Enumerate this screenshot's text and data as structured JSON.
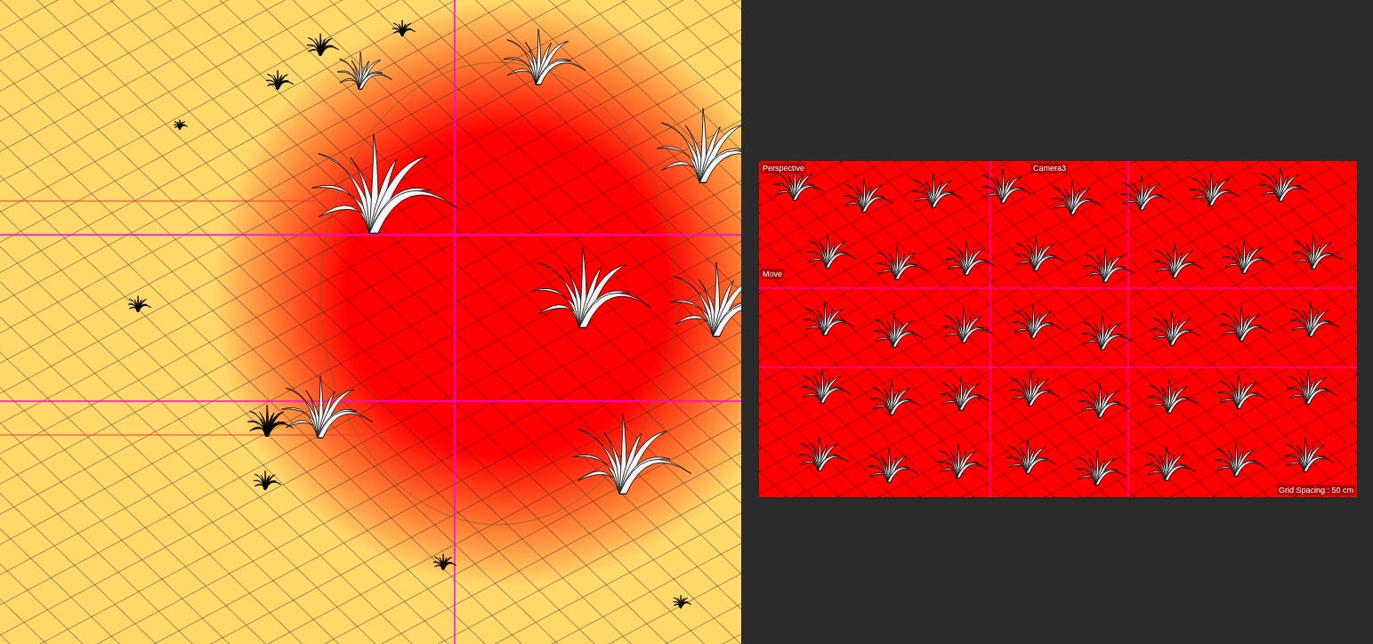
{
  "preview": {
    "view_label": "Perspective",
    "camera_label": "Camera3",
    "tool_label": "Move",
    "grid_spacing": "Grid Spacing : 50 cm"
  }
}
